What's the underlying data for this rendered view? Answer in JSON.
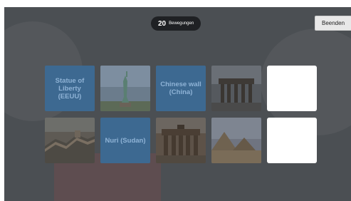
{
  "header": {
    "moves_count": "20",
    "moves_label": "Bewegungen",
    "quit_label": "Beenden"
  },
  "board": {
    "row1": [
      {
        "kind": "text",
        "label": "Statue of Liberty (EEUU)"
      },
      {
        "kind": "photo",
        "icon": "statue-of-liberty-photo"
      },
      {
        "kind": "text",
        "label": "Chinese wall (China)"
      },
      {
        "kind": "photo",
        "icon": "brandenburg-gate-photo"
      },
      {
        "kind": "blank"
      }
    ],
    "row2": [
      {
        "kind": "photo",
        "icon": "great-wall-photo"
      },
      {
        "kind": "text",
        "label": "Nuri (Sudan)"
      },
      {
        "kind": "photo",
        "icon": "brandenburg-gate-photo"
      },
      {
        "kind": "photo",
        "icon": "pyramids-photo"
      },
      {
        "kind": "blank"
      }
    ]
  },
  "colors": {
    "overlay": "#4b4f53",
    "text_card": "#3d6991",
    "text_card_label": "#8fb3d6",
    "pill": "#1f2124"
  }
}
